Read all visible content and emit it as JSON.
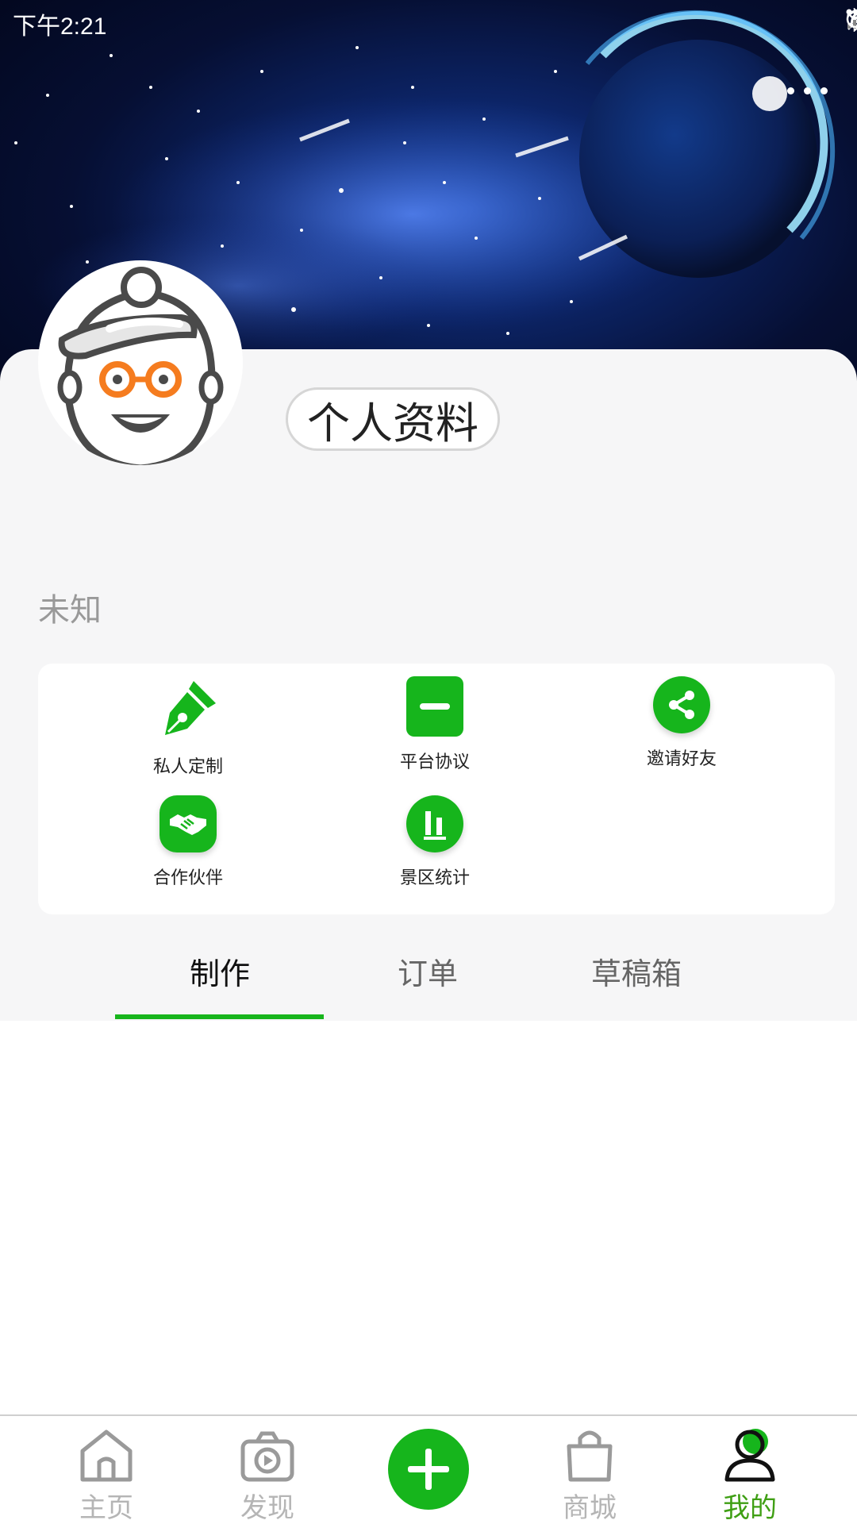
{
  "status_bar": {
    "time": "下午2:21"
  },
  "profile": {
    "button_label": "个人资料",
    "name": "未知"
  },
  "functions": [
    {
      "label": "私人定制",
      "icon": "pen-icon"
    },
    {
      "label": "平台协议",
      "icon": "document-icon"
    },
    {
      "label": "邀请好友",
      "icon": "share-icon"
    },
    {
      "label": "合作伙伴",
      "icon": "handshake-icon"
    },
    {
      "label": "景区统计",
      "icon": "bar-chart-icon"
    }
  ],
  "tabs": [
    {
      "label": "制作",
      "active": true
    },
    {
      "label": "订单",
      "active": false
    },
    {
      "label": "草稿箱",
      "active": false
    }
  ],
  "bottom_nav": [
    {
      "label": "主页",
      "icon": "home-icon"
    },
    {
      "label": "发现",
      "icon": "camera-icon"
    },
    {
      "label": "",
      "icon": "add-icon"
    },
    {
      "label": "商城",
      "icon": "shopping-bag-icon"
    },
    {
      "label": "我的",
      "icon": "user-icon",
      "active": true
    }
  ],
  "colors": {
    "accent": "#16b51c",
    "active_nav": "#3f9f14",
    "card_bg": "#f6f6f7"
  }
}
